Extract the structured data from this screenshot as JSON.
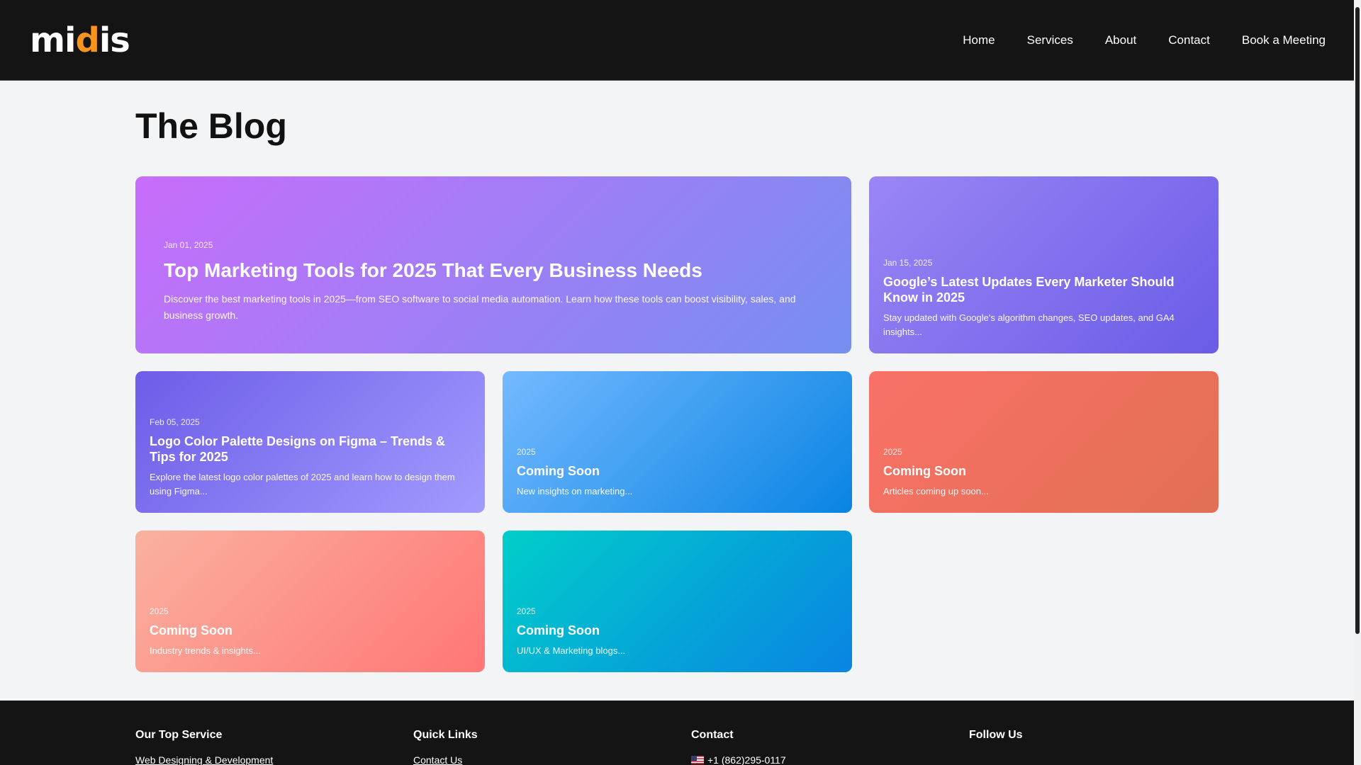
{
  "header": {
    "logo": {
      "text_before": "mi",
      "text_accent": "d",
      "text_after": "is"
    },
    "nav": [
      "Home",
      "Services",
      "About",
      "Contact",
      "Book a Meeting"
    ]
  },
  "page": {
    "title": "The Blog"
  },
  "cards": [
    {
      "date": "Jan 01, 2025",
      "title": "Top Marketing Tools for 2025 That Every Business Needs",
      "excerpt": "Discover the best marketing tools in 2025—from SEO software to social media automation. Learn how these tools can boost visibility, sales, and business growth.",
      "gradient": [
        "#c86dfb",
        "#768ff0"
      ]
    },
    {
      "date": "Jan 15, 2025",
      "title": "Google’s Latest Updates Every Marketer Should Know in 2025",
      "excerpt": "Stay updated with Google's algorithm changes, SEO updates, and GA4 insights...",
      "gradient": [
        "#9a86f5",
        "#6b5ce7"
      ]
    },
    {
      "date": "Feb 05, 2025",
      "title": "Logo Color Palette Designs on Figma – Trends & Tips for 2025",
      "excerpt": "Explore the latest logo color palettes of 2025 and learn how to design them using Figma...",
      "gradient": [
        "#6d5ce8",
        "#a29bfe"
      ]
    },
    {
      "date": "2025",
      "title": "Coming Soon",
      "excerpt": "New insights on marketing...",
      "gradient": [
        "#74b9ff",
        "#0984e3"
      ]
    },
    {
      "date": "2025",
      "title": "Coming Soon",
      "excerpt": "Articles coming up soon...",
      "gradient": [
        "#fa7167",
        "#e17055"
      ]
    },
    {
      "date": "2025",
      "title": "Coming Soon",
      "excerpt": "Industry trends & insights...",
      "gradient": [
        "#fab1a0",
        "#ff7675"
      ]
    },
    {
      "date": "2025",
      "title": "Coming Soon",
      "excerpt": "UI/UX & Marketing blogs...",
      "gradient": [
        "#00cec9",
        "#0984e3"
      ]
    }
  ],
  "footer": {
    "service": {
      "heading": "Our Top Service",
      "link": "Web Designing & Development"
    },
    "links": {
      "heading": "Quick Links",
      "link": "Contact Us"
    },
    "contact": {
      "heading": "Contact",
      "phone": "+1 (862)295-0117"
    },
    "follow": {
      "heading": "Follow Us"
    }
  }
}
